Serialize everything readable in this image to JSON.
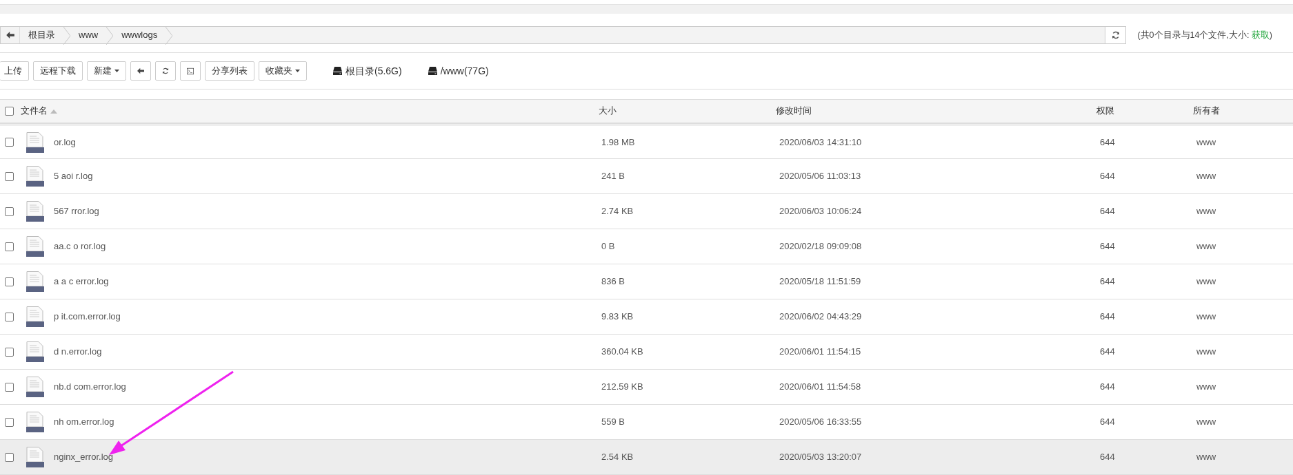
{
  "breadcrumb": {
    "items": [
      "根目录",
      "www",
      "wwwlogs"
    ],
    "summary_prefix": "(共0个目录与14个文件,大小: ",
    "summary_link": "获取",
    "summary_suffix": ")"
  },
  "toolbar": {
    "buttons": [
      {
        "label": "上传",
        "kind": "text"
      },
      {
        "label": "远程下载",
        "kind": "text"
      },
      {
        "label": "新建",
        "kind": "dropdown"
      },
      {
        "kind": "back"
      },
      {
        "kind": "refresh"
      },
      {
        "kind": "terminal"
      },
      {
        "label": "分享列表",
        "kind": "text"
      },
      {
        "label": "收藏夹",
        "kind": "dropdown"
      }
    ],
    "disks": [
      "根目录(5.6G)",
      "/www(77G)"
    ]
  },
  "table": {
    "select_all_checked": false,
    "columns": [
      "文件名",
      "大小",
      "修改时间",
      "权限",
      "所有者"
    ],
    "rows": [
      {
        "name": "or.log",
        "size": "1.98 MB",
        "modified": "2020/06/03 14:31:10",
        "permission": "644",
        "owner": "www",
        "checked": false,
        "highlighted": false
      },
      {
        "name": "5 aoi r.log",
        "size": "241 B",
        "modified": "2020/05/06 11:03:13",
        "permission": "644",
        "owner": "www",
        "checked": false,
        "highlighted": false
      },
      {
        "name": "567 rror.log",
        "size": "2.74 KB",
        "modified": "2020/06/03 10:06:24",
        "permission": "644",
        "owner": "www",
        "checked": false,
        "highlighted": false
      },
      {
        "name": "aa.c o ror.log",
        "size": "0 B",
        "modified": "2020/02/18 09:09:08",
        "permission": "644",
        "owner": "www",
        "checked": false,
        "highlighted": false
      },
      {
        "name": "a a c error.log",
        "size": "836 B",
        "modified": "2020/05/18 11:51:59",
        "permission": "644",
        "owner": "www",
        "checked": false,
        "highlighted": false
      },
      {
        "name": "p it.com.error.log",
        "size": "9.83 KB",
        "modified": "2020/06/02 04:43:29",
        "permission": "644",
        "owner": "www",
        "checked": false,
        "highlighted": false
      },
      {
        "name": "d n.error.log",
        "size": "360.04 KB",
        "modified": "2020/06/01 11:54:15",
        "permission": "644",
        "owner": "www",
        "checked": false,
        "highlighted": false
      },
      {
        "name": "nb.d com.error.log",
        "size": "212.59 KB",
        "modified": "2020/06/01 11:54:58",
        "permission": "644",
        "owner": "www",
        "checked": false,
        "highlighted": false
      },
      {
        "name": "nh om.error.log",
        "size": "559 B",
        "modified": "2020/05/06 16:33:55",
        "permission": "644",
        "owner": "www",
        "checked": false,
        "highlighted": false
      },
      {
        "name": "nginx_error.log",
        "size": "2.54 KB",
        "modified": "2020/05/03 13:20:07",
        "permission": "644",
        "owner": "www",
        "checked": false,
        "highlighted": true
      }
    ]
  }
}
